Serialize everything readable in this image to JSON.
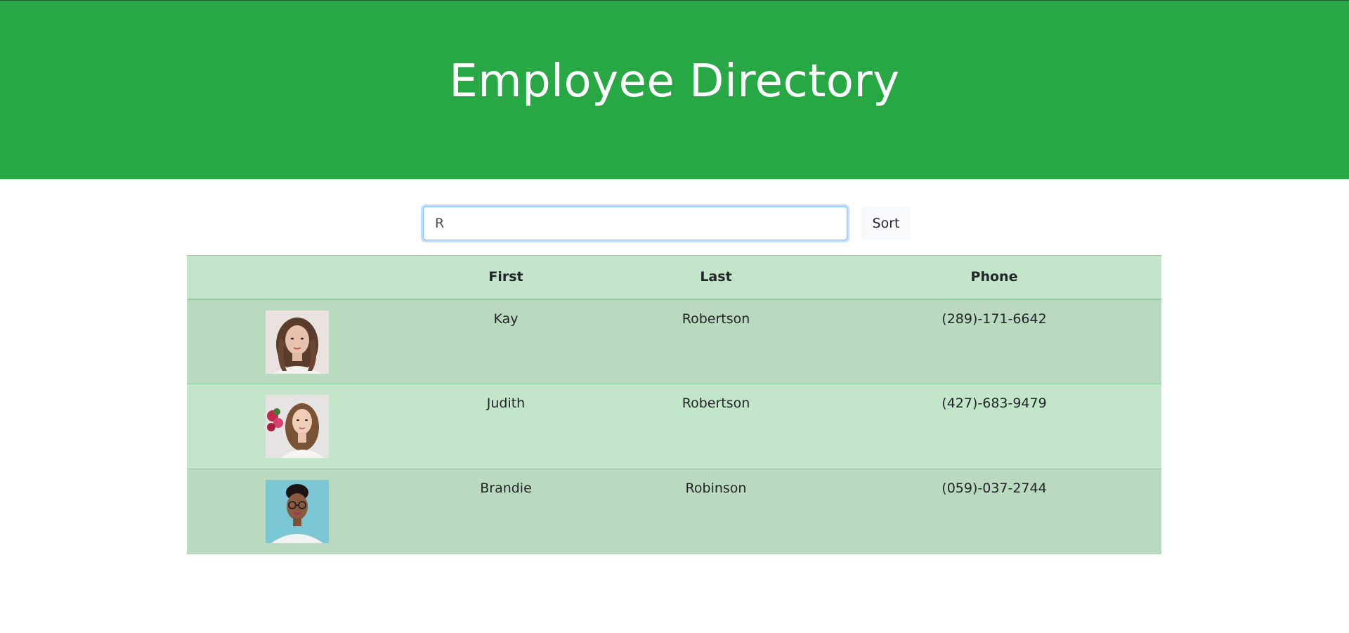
{
  "header": {
    "title": "Employee Directory"
  },
  "search": {
    "value": "R"
  },
  "toolbar": {
    "sort_label": "Sort"
  },
  "table": {
    "columns": [
      "",
      "First",
      "Last",
      "Phone"
    ],
    "rows": [
      {
        "first": "Kay",
        "last": "Robertson",
        "phone": "(289)-171-6642",
        "photo": "woman-portrait-wavy-hair"
      },
      {
        "first": "Judith",
        "last": "Robertson",
        "phone": "(427)-683-9479",
        "photo": "woman-portrait-flowers"
      },
      {
        "first": "Brandie",
        "last": "Robinson",
        "phone": "(059)-037-2744",
        "photo": "woman-portrait-glasses-blue-background"
      }
    ]
  },
  "colors": {
    "header_bg": "#28a745",
    "table_header_bg": "#c3e6cb",
    "table_row_odd_bg": "#badac0",
    "table_row_even_bg": "#c3e6cb"
  }
}
